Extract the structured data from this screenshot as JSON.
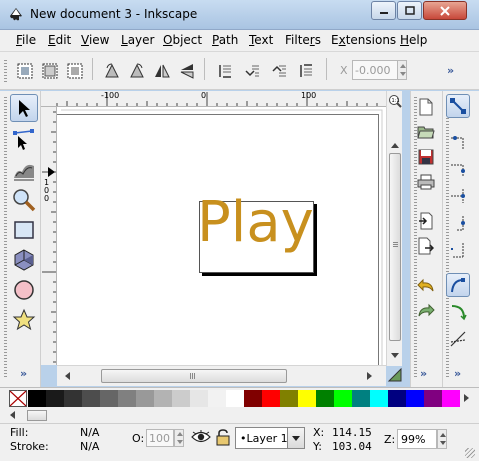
{
  "window": {
    "title": "New document 3 - Inkscape",
    "buttons": [
      "minimize-icon",
      "maximize-icon",
      "close-icon"
    ]
  },
  "menu": [
    {
      "label": "File",
      "key": "F"
    },
    {
      "label": "Edit",
      "key": "E"
    },
    {
      "label": "View",
      "key": "V"
    },
    {
      "label": "Layer",
      "key": "L"
    },
    {
      "label": "Object",
      "key": "O"
    },
    {
      "label": "Path",
      "key": "P"
    },
    {
      "label": "Text",
      "key": "T"
    },
    {
      "label": "Filters",
      "key": "r"
    },
    {
      "label": "Extensions",
      "key": "x"
    },
    {
      "label": "Help",
      "key": "H"
    }
  ],
  "commands_bar": {
    "icons": [
      "select-all-icon",
      "select-all-layers-icon",
      "deselect-icon",
      "rotate-ccw-icon",
      "rotate-cw-icon",
      "flip-horizontal-icon",
      "flip-vertical-icon",
      "lower-to-bottom-icon",
      "lower-icon",
      "raise-icon",
      "raise-to-top-icon"
    ],
    "x_label": "X",
    "x_value": "-0.000",
    "more": "»"
  },
  "rulers": {
    "horizontal_ticks": [
      "-100",
      "0",
      "100"
    ],
    "vertical_ticks": [
      "1",
      "0",
      "0"
    ]
  },
  "canvas": {
    "text": "Play",
    "text_color": "#c8901e"
  },
  "tools": [
    "selector-icon",
    "node-editor-icon",
    "tweak-icon",
    "zoom-icon",
    "rectangle-icon",
    "3d-box-icon",
    "ellipse-icon",
    "star-icon"
  ],
  "tools_more": "»",
  "right_commands": [
    "new-document-icon",
    "open-icon",
    "save-icon",
    "print-icon",
    "import-icon",
    "export-icon",
    "undo-icon",
    "redo-icon"
  ],
  "right_commands_more": "»",
  "snap_controls": [
    "snap-toggle-icon",
    "snap-bbox-icon",
    "snap-bbox-edges-icon",
    "snap-bbox-corners-icon",
    "snap-midpoints-icon",
    "snap-center-icon",
    "snap-nodes-icon",
    "snap-paths-icon",
    "snap-intersections-icon"
  ],
  "snap_more": "»",
  "palette": {
    "colors": [
      "#000000",
      "#1a1a1a",
      "#333333",
      "#4d4d4d",
      "#666666",
      "#808080",
      "#999999",
      "#b3b3b3",
      "#cccccc",
      "#e6e6e6",
      "#f2f2f2",
      "#ffffff",
      "#800000",
      "#ff0000",
      "#808000",
      "#ffff00",
      "#008000",
      "#00ff00",
      "#008080",
      "#00ffff",
      "#000080",
      "#0000ff",
      "#800080",
      "#ff00ff"
    ]
  },
  "status": {
    "fill_label": "Fill:",
    "fill_value": "N/A",
    "stroke_label": "Stroke:",
    "stroke_value": "N/A",
    "opacity_label": "O:",
    "opacity_value": "100",
    "layer_value": "•Layer 1",
    "x_label": "X:",
    "x_value": "114.15",
    "y_label": "Y:",
    "y_value": "103.04",
    "zoom_label": "Z:",
    "zoom_value": "99%"
  }
}
